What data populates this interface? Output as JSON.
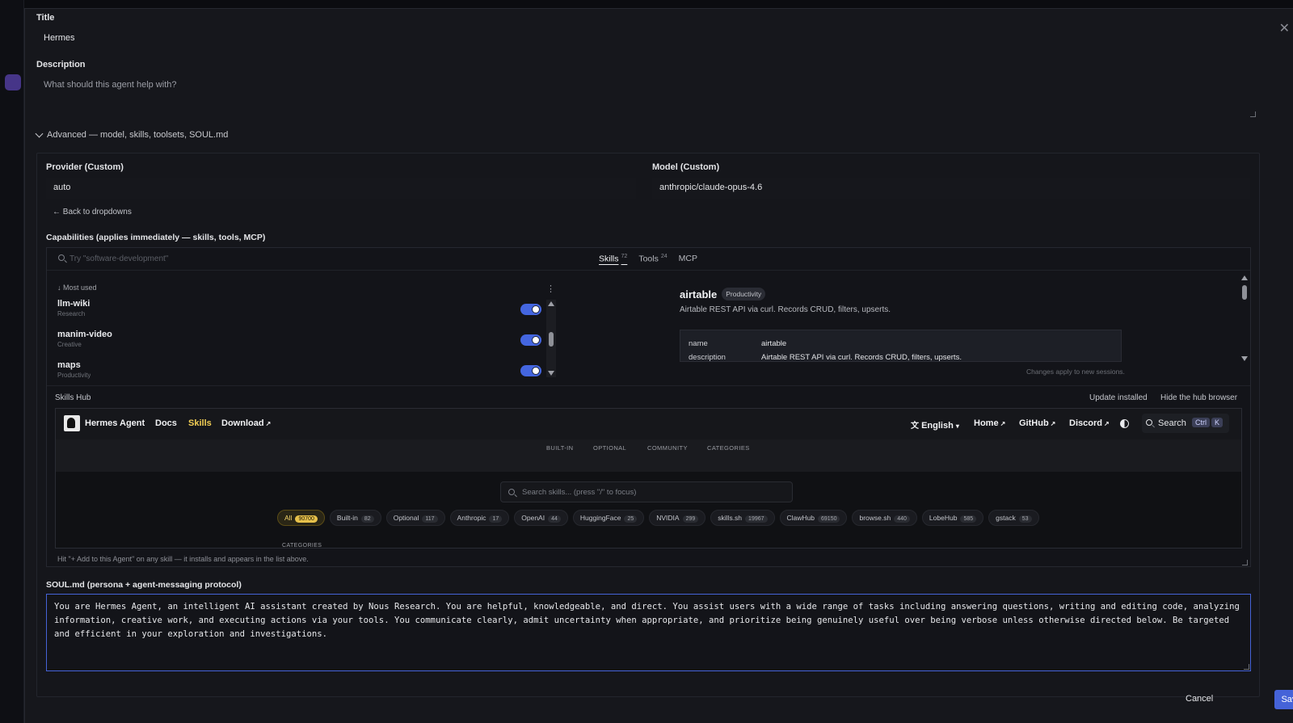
{
  "form": {
    "title_label": "Title",
    "title_value": "Hermes",
    "description_label": "Description",
    "description_placeholder": "What should this agent help with?",
    "advanced_label": "Advanced — model, skills, toolsets, SOUL.md"
  },
  "advanced": {
    "provider_label": "Provider (Custom)",
    "provider_value": "auto",
    "model_label": "Model (Custom)",
    "model_value": "anthropic/claude-opus-4.6",
    "back_link": "← Back to dropdowns",
    "capabilities_label": "Capabilities (applies immediately — skills, tools, MCP)"
  },
  "capabilities": {
    "search_placeholder": "Try \"software-development\"",
    "tabs": [
      {
        "label": "Skills",
        "count": "72"
      },
      {
        "label": "Tools",
        "count": "24"
      },
      {
        "label": "MCP",
        "count": ""
      }
    ],
    "sort_label": "↓ Most used",
    "skills": [
      {
        "name": "llm-wiki",
        "category": "Research",
        "enabled": true
      },
      {
        "name": "manim-video",
        "category": "Creative",
        "enabled": true
      },
      {
        "name": "maps",
        "category": "Productivity",
        "enabled": true
      }
    ],
    "detail": {
      "name": "airtable",
      "badge": "Productivity",
      "description": "Airtable REST API via curl. Records CRUD, filters, upserts.",
      "meta": [
        {
          "key": "name",
          "value": "airtable"
        },
        {
          "key": "description",
          "value": "Airtable REST API via curl. Records CRUD, filters, upserts."
        }
      ],
      "changes_note": "Changes apply to new sessions."
    }
  },
  "hub": {
    "title": "Skills Hub",
    "update_installed": "Update installed",
    "hide_browser": "Hide the hub browser",
    "nav": {
      "brand": "Hermes Agent",
      "docs": "Docs",
      "skills": "Skills",
      "download": "Download",
      "language": "English",
      "home": "Home",
      "github": "GitHub",
      "discord": "Discord",
      "search": "Search",
      "kbd_ctrl": "Ctrl",
      "kbd_k": "K"
    },
    "subnav": [
      "BUILT-IN",
      "OPTIONAL",
      "COMMUNITY",
      "CATEGORIES"
    ],
    "search_placeholder": "Search skills... (press \"/\" to focus)",
    "chips": [
      {
        "label": "All",
        "count": "90700",
        "active": true
      },
      {
        "label": "Built-in",
        "count": "82"
      },
      {
        "label": "Optional",
        "count": "117"
      },
      {
        "label": "Anthropic",
        "count": "17"
      },
      {
        "label": "OpenAI",
        "count": "44"
      },
      {
        "label": "HuggingFace",
        "count": "25"
      },
      {
        "label": "NVIDIA",
        "count": "299"
      },
      {
        "label": "skills.sh",
        "count": "19967"
      },
      {
        "label": "ClawHub",
        "count": "69150"
      },
      {
        "label": "browse.sh",
        "count": "440"
      },
      {
        "label": "LobeHub",
        "count": "585"
      },
      {
        "label": "gstack",
        "count": "53"
      }
    ],
    "categories_peek": "CATEGORIES",
    "hint": "Hit \"+ Add to this Agent\" on any skill — it installs and appears in the list above."
  },
  "soul": {
    "label": "SOUL.md (persona + agent-messaging protocol)",
    "text": "You are Hermes Agent, an intelligent AI assistant created by Nous Research. You are helpful, knowledgeable, and direct. You assist users with a wide range of tasks including answering questions, writing and editing code, analyzing information, creative work, and executing actions via your tools. You communicate clearly, admit uncertainty when appropriate, and prioritize being genuinely useful over being verbose unless otherwise directed below. Be targeted and efficient in your exploration and investigations."
  },
  "actions": {
    "cancel": "Cancel",
    "save": "Save"
  },
  "colors": {
    "accent": "#4563d8",
    "toggle_on": "#4466e0",
    "hub_highlight": "#e7c14b"
  }
}
